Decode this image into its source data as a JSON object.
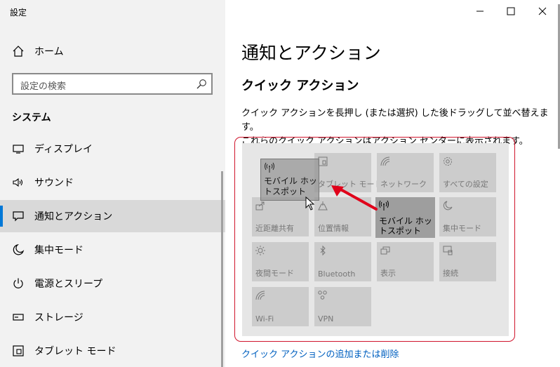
{
  "window": {
    "title": "設定"
  },
  "sidebar": {
    "home_label": "ホーム",
    "search_placeholder": "設定の検索",
    "section_title": "システム",
    "items": [
      {
        "label": "ディスプレイ",
        "icon": "display-icon"
      },
      {
        "label": "サウンド",
        "icon": "speaker-icon"
      },
      {
        "label": "通知とアクション",
        "icon": "notification-icon",
        "selected": true
      },
      {
        "label": "集中モード",
        "icon": "moon-icon"
      },
      {
        "label": "電源とスリープ",
        "icon": "power-icon"
      },
      {
        "label": "ストレージ",
        "icon": "storage-icon"
      },
      {
        "label": "タブレット モード",
        "icon": "tablet-mode-icon"
      }
    ]
  },
  "main": {
    "title": "通知とアクション",
    "subtitle": "クイック アクション",
    "description_line1": "クイック アクションを長押し (または選択) した後ドラッグして並べ替えます。",
    "description_line2": "これらのクイック アクションはアクション センターに表示されます。",
    "tiles": [
      {
        "label": "タブレット モード",
        "icon": "tablet-icon"
      },
      {
        "label": "ネットワーク",
        "icon": "network-icon"
      },
      {
        "label": "すべての設定",
        "icon": "gear-icon"
      },
      {
        "label": "近距離共有",
        "icon": "share-icon"
      },
      {
        "label": "位置情報",
        "icon": "location-icon"
      },
      {
        "label": "モバイル ホットスポット",
        "icon": "hotspot-icon",
        "active": true
      },
      {
        "label": "集中モード",
        "icon": "moon-icon"
      },
      {
        "label": "夜間モード",
        "icon": "brightness-icon"
      },
      {
        "label": "Bluetooth",
        "icon": "bluetooth-icon"
      },
      {
        "label": "表示",
        "icon": "project-icon"
      },
      {
        "label": "接続",
        "icon": "connect-icon"
      },
      {
        "label": "Wi-Fi",
        "icon": "wifi-icon"
      },
      {
        "label": "VPN",
        "icon": "vpn-icon"
      }
    ],
    "dragging_tile_label": "モバイル ホットスポット",
    "link_label": "クイック アクションの追加または削除"
  },
  "colors": {
    "accent": "#0078d7",
    "highlight_frame": "#d0142c",
    "arrow": "#e0001a",
    "link": "#0060c0"
  }
}
